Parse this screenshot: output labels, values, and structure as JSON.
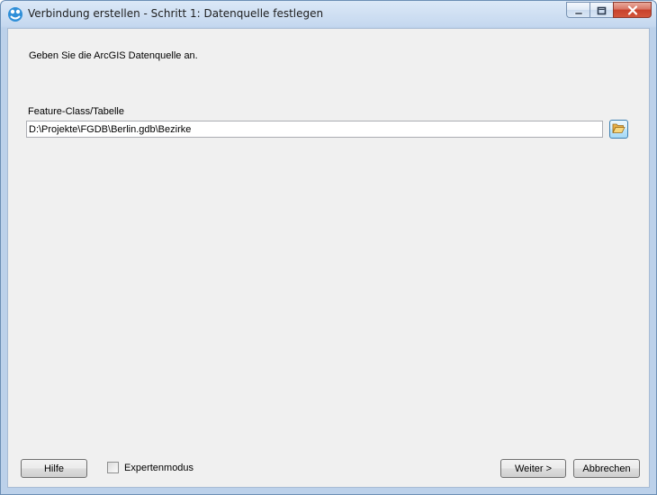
{
  "window": {
    "title": "Verbindung erstellen - Schritt 1: Datenquelle festlegen",
    "app_icon": "fme-app-icon",
    "caption_buttons": [
      "minimize-icon",
      "maximize-icon",
      "close-icon"
    ]
  },
  "content": {
    "instruction": "Geben Sie die ArcGIS Datenquelle an.",
    "field_label": "Feature-Class/Tabelle",
    "path_value": "D:\\Projekte\\FGDB\\Berlin.gdb\\Bezirke",
    "browse_icon": "folder-open-icon"
  },
  "footer": {
    "help_label": "Hilfe",
    "expert_mode_label": "Expertenmodus",
    "expert_mode_checked": false,
    "next_label": "Weiter >",
    "cancel_label": "Abbrechen"
  },
  "colors": {
    "frame": "#bcd1ea",
    "client_bg": "#f0f0f0",
    "close_button": "#c8412b",
    "browse_button": "#a7d9f5"
  }
}
